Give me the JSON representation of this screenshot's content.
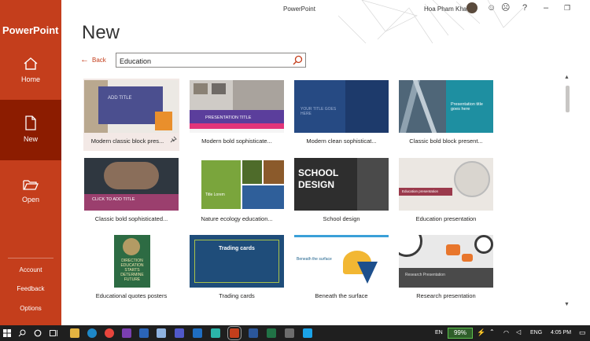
{
  "app": {
    "brand": "PowerPoint",
    "window_title": "PowerPoint",
    "user_name": "Hoa Pham Khac",
    "help": "?"
  },
  "sidebar": {
    "items": [
      {
        "label": "Home",
        "icon": "home-icon"
      },
      {
        "label": "New",
        "icon": "new-document-icon",
        "selected": true
      },
      {
        "label": "Open",
        "icon": "folder-open-icon"
      }
    ],
    "bottom": [
      "Account",
      "Feedback",
      "Options"
    ]
  },
  "main": {
    "title": "New",
    "back_label": "Back",
    "search_value": "Education"
  },
  "templates": [
    {
      "label": "Modern classic block pres...",
      "thumb_text": "ADD TITLE"
    },
    {
      "label": "Modern bold sophisticate...",
      "thumb_text": "PRESENTATION TITLE"
    },
    {
      "label": "Modern clean sophisticat...",
      "thumb_text": "YOUR TITLE GOES HERE"
    },
    {
      "label": "Classic bold block present...",
      "thumb_text": "Presentation title goes here"
    },
    {
      "label": "Classic bold sophisticated...",
      "thumb_text": "CLICK TO ADD TITLE"
    },
    {
      "label": "Nature ecology education...",
      "thumb_text": "Title Lorem"
    },
    {
      "label": "School design",
      "thumb_text": "SCHOOL DESIGN"
    },
    {
      "label": "Education presentation",
      "thumb_text": "Education presentation"
    },
    {
      "label": "Educational quotes posters",
      "thumb_text": "DIRECTION EDUCATION STARTS DETERMINE FUTURE"
    },
    {
      "label": "Trading cards",
      "thumb_text": "Trading cards"
    },
    {
      "label": "Beneath the surface",
      "thumb_text": "Beneath the surface"
    },
    {
      "label": "Research presentation",
      "thumb_text": "Research Presentation"
    }
  ],
  "taskbar": {
    "language": "EN",
    "battery": "99%",
    "input_lang": "ENG",
    "time": "4:05 PM"
  },
  "colors": {
    "accent": "#c43e1c",
    "sidebar_selected": "#8c1c00",
    "taskbar": "#1f1f1f"
  }
}
